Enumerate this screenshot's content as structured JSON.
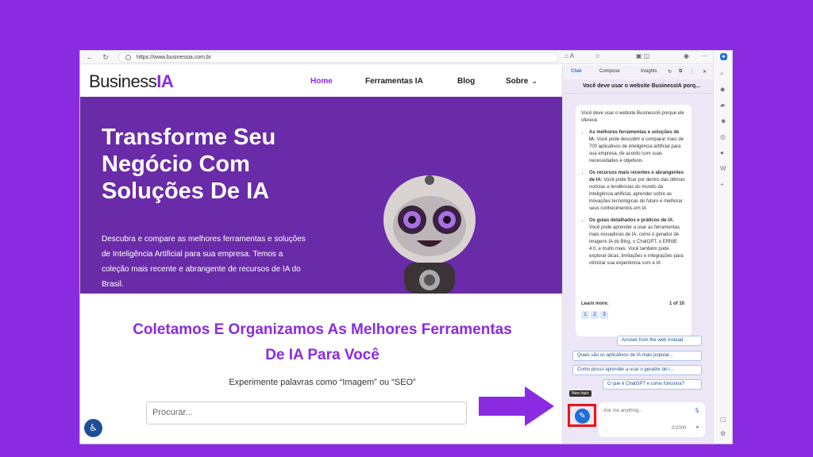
{
  "browser": {
    "url": "https://www.businessia.com.br",
    "back": "←",
    "refresh": "↻"
  },
  "site": {
    "logo_main": "Business",
    "logo_accent": "IA",
    "nav": [
      "Home",
      "Ferramentas IA",
      "Blog",
      "Sobre"
    ],
    "hero_title": "Transforme Seu Negócio Com Soluções De IA",
    "hero_text": "Descubra e compare as melhores ferramentas e soluções de Inteligência Artificial para sua empresa. Temos a coleção mais recente e abrangente de recursos de IA do Brasil.",
    "section_title": "Coletamos E Organizamos As Melhores Ferramentas De IA Para Você",
    "suggest": "Experimente palavras como “Imagem” ou “SEO”",
    "search_placeholder": "Procurar..."
  },
  "pane": {
    "tabs": [
      "Chat",
      "Compose",
      "Insights"
    ],
    "subject": "Você deve usar o website BusinessIA porq...",
    "intro": "Você deve usar o website BusinessIA porque ele oferece:",
    "items": [
      {
        "bold": "As melhores ferramentas e soluções de IA:",
        "text": " Você pode descobrir e comparar mais de 700 aplicativos de inteligência artificial para sua empresa, de acordo com suas necessidades e objetivos"
      },
      {
        "bold": "Os recursos mais recentes e abrangentes de IA:",
        "text": " Você pode ficar por dentro das últimas notícias e tendências do mundo da inteligência artificial, aprender sobre as inovações tecnológicas do futuro e melhorar seus conhecimentos em IA"
      },
      {
        "bold": "Os guias detalhados e práticos de IA:",
        "text": " Você pode aprender a usar as ferramentas mais inovadoras de IA, como o gerador de imagens IA do Bing, o ChatGPT, o ERNIE 4.0, e muito mais. Você também pode explorar dicas, limitações e integrações para otimizar sua experiência com a IA"
      }
    ],
    "learn_more": "Learn more:",
    "pager": "1 of 10",
    "sources": [
      "1",
      "2",
      "3"
    ],
    "suggestions": [
      "Answer from the web instead",
      "Quais são os aplicativos de IA mais popular...",
      "Como posso aprender a usar o gerador de i...",
      "O que é ChatGPT e como funciona?"
    ],
    "tooltip": "New topic",
    "ask_placeholder": "Ask me anything...",
    "counter": "0/2000"
  },
  "colors": {
    "brand": "#8a2be2",
    "hero": "#6a2ba8",
    "highlight": "#e11"
  }
}
